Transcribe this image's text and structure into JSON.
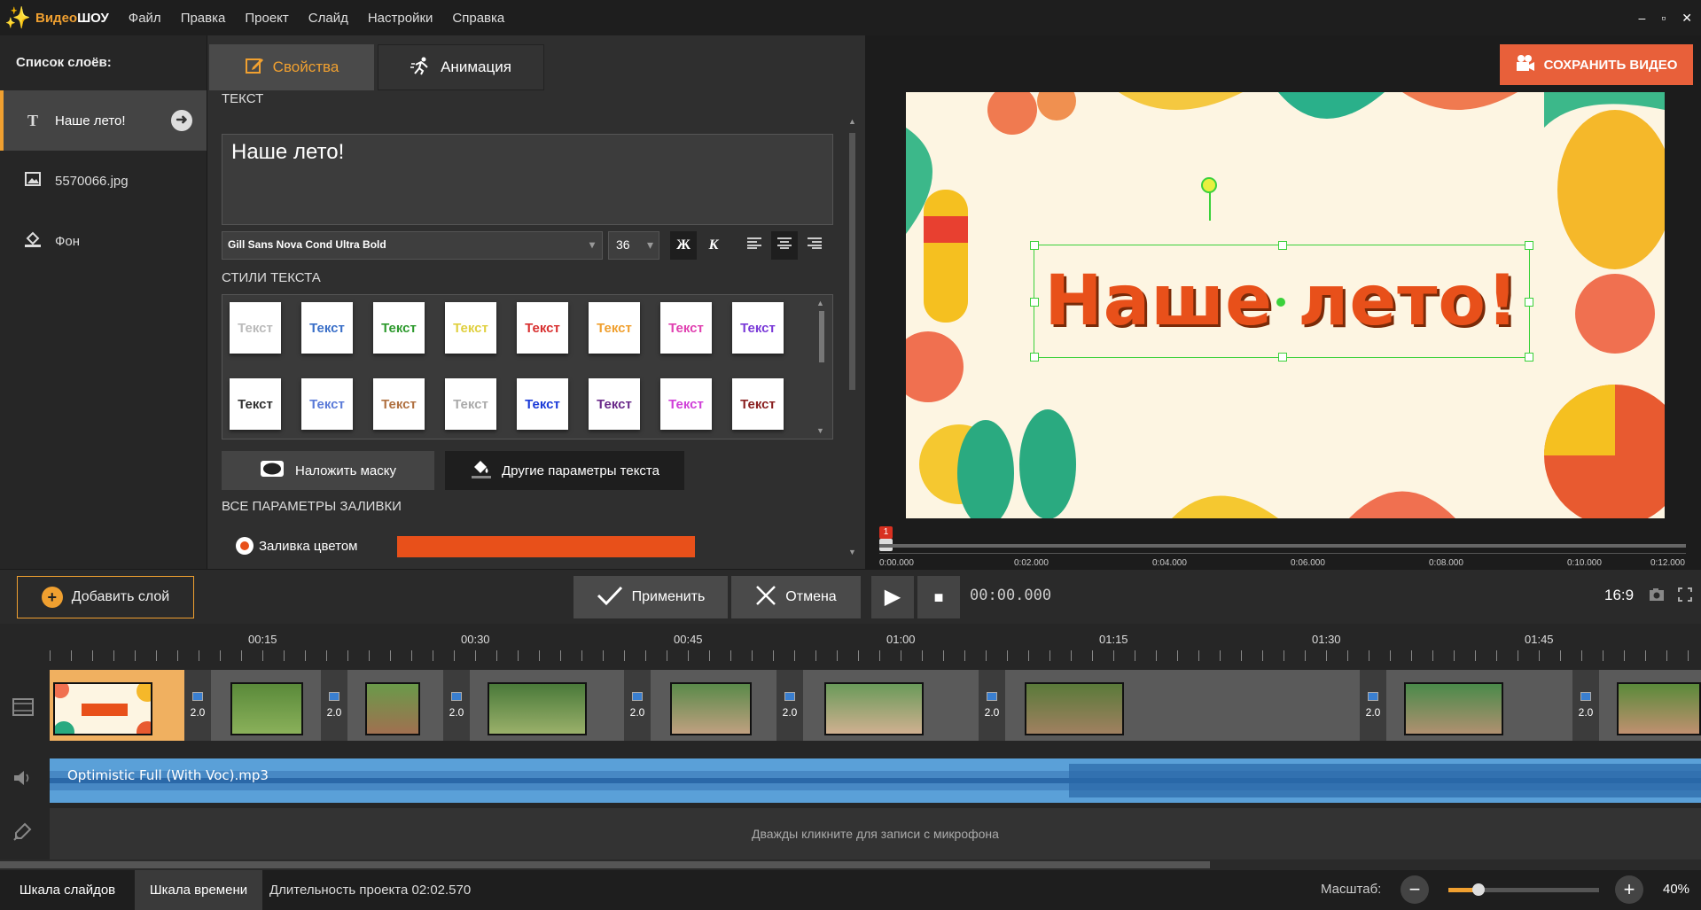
{
  "app": {
    "brand_a": "Видео",
    "brand_b": "ШОУ"
  },
  "menu": [
    "Файл",
    "Правка",
    "Проект",
    "Слайд",
    "Настройки",
    "Справка"
  ],
  "window_controls": [
    "–",
    "▫",
    "✕"
  ],
  "layers": {
    "title": "Список слоёв:",
    "items": [
      {
        "label": "Наше лето!",
        "icon": "text-icon",
        "active": true
      },
      {
        "label": "5570066.jpg",
        "icon": "image-icon",
        "active": false
      },
      {
        "label": "Фон",
        "icon": "fill-icon",
        "active": false
      }
    ]
  },
  "props": {
    "tab_properties": "Свойства",
    "tab_animation": "Анимация",
    "text_section": "ТЕКСТ",
    "text_value": "Наше лето!",
    "font_name": "Gill Sans Nova Cond Ultra Bold",
    "font_size": "36",
    "bold_label": "Ж",
    "italic_label": "К",
    "styles_section": "СТИЛИ ТЕКСТА",
    "style_label": "Текст",
    "styles": [
      {
        "color": "#bbbbbb"
      },
      {
        "color": "#3a6fc8"
      },
      {
        "color": "#2e9a2e"
      },
      {
        "color": "#e0d040"
      },
      {
        "color": "#d83030"
      },
      {
        "color": "#f0a030"
      },
      {
        "color": "#e040b0"
      },
      {
        "color": "#7a3ad8"
      },
      {
        "color": "#333333"
      },
      {
        "color": "#5a7ad8"
      },
      {
        "color": "#b07040"
      },
      {
        "color": "#aaaaaa"
      },
      {
        "color": "#1a3ad8"
      },
      {
        "color": "#6a2a8a"
      },
      {
        "color": "#d040d8"
      },
      {
        "color": "#8a2020"
      }
    ],
    "mask_button": "Наложить маску",
    "other_params_button": "Другие параметры текста",
    "fill_section": "ВСЕ ПАРАМЕТРЫ ЗАЛИВКИ",
    "fill_color_label": "Заливка цветом",
    "fill_color": "#e8501a"
  },
  "preview": {
    "save_button": "СОХРАНИТЬ ВИДЕО",
    "canvas_text": "Наше лето!",
    "marker": "1",
    "ruler_ticks": [
      "0:00.000",
      "0:02.000",
      "0:04.000",
      "0:06.000",
      "0:08.000",
      "0:10.000",
      "0:12.000"
    ]
  },
  "controls": {
    "add_layer": "Добавить слой",
    "apply": "Применить",
    "cancel": "Отмена",
    "timecode": "00:00.000",
    "aspect": "16:9"
  },
  "timeline": {
    "ticks": [
      "00:15",
      "00:30",
      "00:45",
      "01:00",
      "01:15",
      "01:30",
      "01:45"
    ],
    "transition_label": "2.0",
    "audio_label": "Optimistic Full (With Voc).mp3",
    "mic_hint": "Дважды кликните для записи с микрофона"
  },
  "status": {
    "tab_slides": "Шкала слайдов",
    "tab_timeline": "Шкала времени",
    "duration": "Длительность проекта 02:02.570",
    "zoom_label": "Масштаб:",
    "zoom_value": "40%",
    "zoom_fraction": 0.2
  }
}
